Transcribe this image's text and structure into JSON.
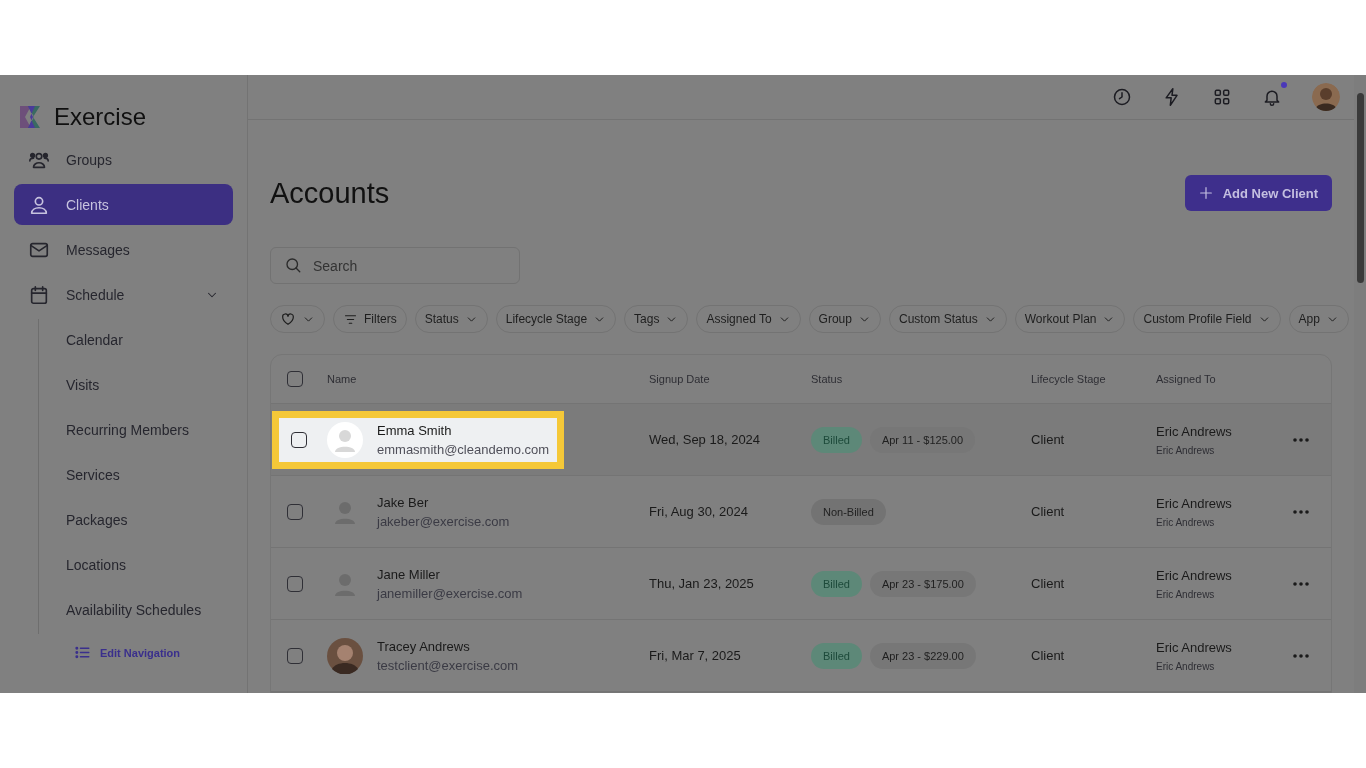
{
  "brand": {
    "name": "Exercise"
  },
  "sidebar": {
    "items": [
      {
        "label": "Groups",
        "kind": "groups",
        "selected": false
      },
      {
        "label": "Clients",
        "kind": "person",
        "selected": true
      },
      {
        "label": "Messages",
        "kind": "mail",
        "selected": false
      },
      {
        "label": "Schedule",
        "kind": "calendar",
        "selected": false,
        "expanded": true,
        "children": [
          {
            "label": "Calendar",
            "selected": false
          },
          {
            "label": "Visits",
            "selected": false
          },
          {
            "label": "Recurring Members",
            "selected": false
          },
          {
            "label": "Services",
            "selected": false
          },
          {
            "label": "Packages",
            "selected": false
          },
          {
            "label": "Locations",
            "selected": false
          },
          {
            "label": "Availability Schedules",
            "selected": false
          }
        ]
      }
    ],
    "edit_navigation": "Edit Navigation"
  },
  "topbar": {
    "notifications_unread": true
  },
  "page": {
    "title": "Accounts",
    "add_button": "Add New Client"
  },
  "search": {
    "placeholder": "Search"
  },
  "filters": [
    {
      "kind": "favorites"
    },
    {
      "kind": "filters",
      "label": "Filters"
    },
    {
      "kind": "dropdown",
      "label": "Status"
    },
    {
      "kind": "dropdown",
      "label": "Lifecycle Stage"
    },
    {
      "kind": "dropdown",
      "label": "Tags"
    },
    {
      "kind": "dropdown",
      "label": "Assigned To"
    },
    {
      "kind": "dropdown",
      "label": "Group"
    },
    {
      "kind": "dropdown",
      "label": "Custom Status"
    },
    {
      "kind": "dropdown",
      "label": "Workout Plan"
    },
    {
      "kind": "dropdown",
      "label": "Custom Profile Field"
    },
    {
      "kind": "dropdown",
      "label": "App"
    }
  ],
  "table": {
    "select_all_checked": false,
    "columns": [
      "Name",
      "Signup Date",
      "Status",
      "Lifecycle Stage",
      "Assigned To"
    ],
    "rows": [
      {
        "checked": false,
        "highlighted": true,
        "avatar": {
          "kind": "placeholder"
        },
        "name": "Emma Smith",
        "email": "emmasmith@cleandemo.com",
        "signup": "Wed, Sep 18, 2024",
        "status": {
          "kind": "billed",
          "label": "Billed"
        },
        "billing": "Apr 11 - $125.00",
        "stage": "Client",
        "assigned": "Eric Andrews",
        "assigned_sub": "Eric Andrews"
      },
      {
        "checked": false,
        "highlighted": false,
        "avatar": {
          "kind": "placeholder"
        },
        "name": "Jake Ber",
        "email": "jakeber@exercise.com",
        "signup": "Fri, Aug 30, 2024",
        "status": {
          "kind": "non-billed",
          "label": "Non-Billed"
        },
        "stage": "Client",
        "assigned": "Eric Andrews",
        "assigned_sub": "Eric Andrews"
      },
      {
        "checked": false,
        "highlighted": false,
        "avatar": {
          "kind": "placeholder"
        },
        "name": "Jane Miller",
        "email": "janemiller@exercise.com",
        "signup": "Thu, Jan 23, 2025",
        "status": {
          "kind": "billed",
          "label": "Billed"
        },
        "billing": "Apr 23 - $175.00",
        "stage": "Client",
        "assigned": "Eric Andrews",
        "assigned_sub": "Eric Andrews"
      },
      {
        "checked": false,
        "highlighted": false,
        "avatar": {
          "kind": "photo"
        },
        "name": "Tracey Andrews",
        "email": "testclient@exercise.com",
        "signup": "Fri, Mar 7, 2025",
        "status": {
          "kind": "billed",
          "label": "Billed"
        },
        "billing": "Apr 23 - $229.00",
        "stage": "Client",
        "assigned": "Eric Andrews",
        "assigned_sub": "Eric Andrews"
      }
    ]
  }
}
